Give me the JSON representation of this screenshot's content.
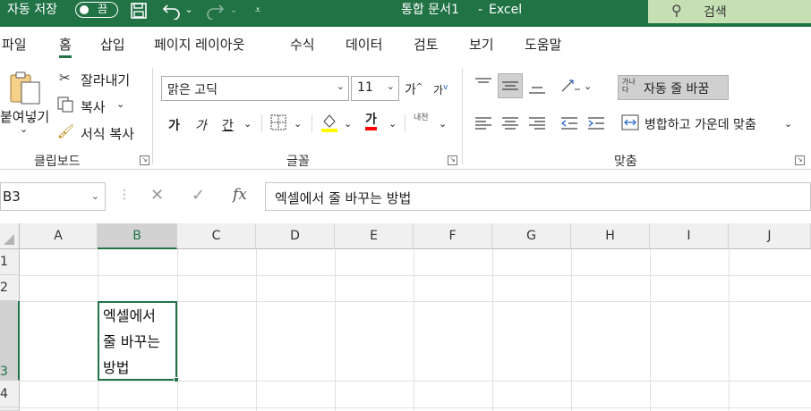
{
  "titlebar": {
    "autosave_label": "자동 저장",
    "autosave_state": "끔",
    "title": "통합 문서1",
    "separator": "-",
    "app": "Excel",
    "search_label": "검색"
  },
  "tabs": [
    {
      "label": "파일"
    },
    {
      "label": "홈"
    },
    {
      "label": "삽입"
    },
    {
      "label": "페이지 레이아웃"
    },
    {
      "label": "수식"
    },
    {
      "label": "데이터"
    },
    {
      "label": "검토"
    },
    {
      "label": "보기"
    },
    {
      "label": "도움말"
    }
  ],
  "ribbon": {
    "clipboard": {
      "paste": "붙여넣기",
      "cut": "잘라내기",
      "copy": "복사",
      "format_painter": "서식 복사",
      "group_label": "클립보드"
    },
    "font": {
      "font_name": "맑은 고딕",
      "font_size": "11",
      "bold": "가",
      "italic": "가",
      "underline": "간",
      "font_color_glyph": "가",
      "phonetic_glyph": "내천",
      "grow_glyph": "가",
      "shrink_glyph": "가",
      "group_label": "글꼴"
    },
    "alignment": {
      "wrap_text": "자동 줄 바꿈",
      "wrap_icon_text": "가나다",
      "merge_center": "병합하고 가운데 맞춤",
      "group_label": "맞춤"
    }
  },
  "formula_bar": {
    "name_box": "B3",
    "fx": "fx",
    "content": "엑셀에서 줄 바꾸는 방법"
  },
  "sheet": {
    "columns": [
      "A",
      "B",
      "C",
      "D",
      "E",
      "F",
      "G",
      "H",
      "I",
      "J"
    ],
    "rows": [
      "1",
      "2",
      "3",
      "4"
    ],
    "selected_cell": "B3",
    "cell_b3_lines": [
      "엑셀에서",
      "줄 바꾸는",
      "방법"
    ]
  },
  "colors": {
    "excel_green": "#217346",
    "search_bg": "#c6e0b4",
    "font_highlight": "#ffff00",
    "font_color": "#ff0000"
  }
}
